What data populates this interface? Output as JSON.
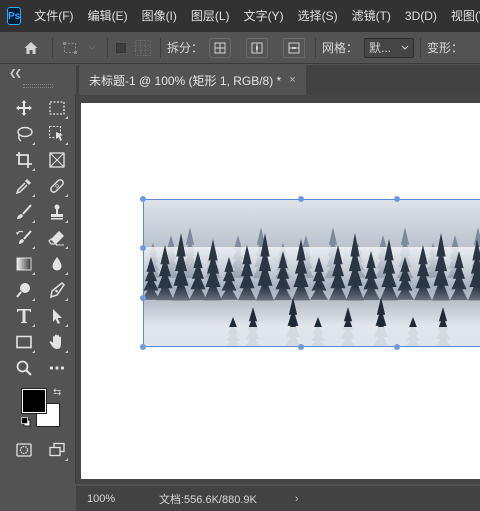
{
  "app": {
    "logo": "Ps"
  },
  "menu": [
    "文件(F)",
    "编辑(E)",
    "图像(I)",
    "图层(L)",
    "文字(Y)",
    "选择(S)",
    "滤镜(T)",
    "3D(D)",
    "视图(V)"
  ],
  "options": {
    "split_label": "拆分：",
    "grid_label": "网格：",
    "grid_value": "默...",
    "transform_label": "变形："
  },
  "document": {
    "tab_title": "未标题-1 @ 100% (矩形 1, RGB/8) *",
    "close_glyph": "×"
  },
  "status": {
    "zoom": "100%",
    "doc_size": "文档:556.6K/880.9K",
    "arrow": "›"
  },
  "colors": {
    "foreground": "#000000",
    "background": "#ffffff",
    "accent": "#31a8ff",
    "selection": "#5b8ad8"
  },
  "tools": [
    "move-icon",
    "marquee-icon",
    "lasso-icon",
    "object-select-icon",
    "crop-icon",
    "frame-icon",
    "eyedropper-icon",
    "healing-icon",
    "brush-icon",
    "stamp-icon",
    "history-brush-icon",
    "eraser-icon",
    "gradient-icon",
    "blur-icon",
    "dodge-icon",
    "pen-icon",
    "type-icon",
    "path-select-icon",
    "rectangle-icon",
    "hand-icon",
    "zoom-icon",
    "more-icon",
    "quick-mask-icon",
    "screen-mode-icon"
  ]
}
